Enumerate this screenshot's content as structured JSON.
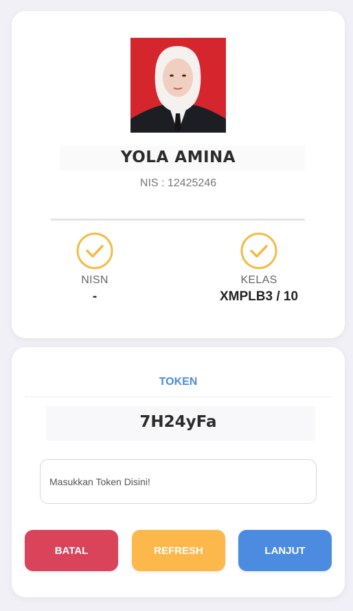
{
  "profile": {
    "name": "YOLA AMINA",
    "nis": "NIS : 12425246",
    "stats": [
      {
        "label": "NISN",
        "value": "-"
      },
      {
        "label": "KELAS",
        "value": "XMPLB3 / 10"
      }
    ]
  },
  "token_panel": {
    "label": "TOKEN",
    "value": "7H24yFa",
    "input_value": "",
    "input_placeholder": "Masukkan Token Disini!"
  },
  "buttons": {
    "cancel": "BATAL",
    "refresh": "REFRESH",
    "next": "LANJUT"
  },
  "colors": {
    "accent_check": "#f4b942",
    "token_label": "#4a8bdc",
    "cancel": "#d9445a",
    "refresh": "#fdb84b",
    "next": "#4b8ce0"
  },
  "icons": {
    "nisn_status": "check-circle-icon",
    "kelas_status": "check-circle-icon"
  }
}
